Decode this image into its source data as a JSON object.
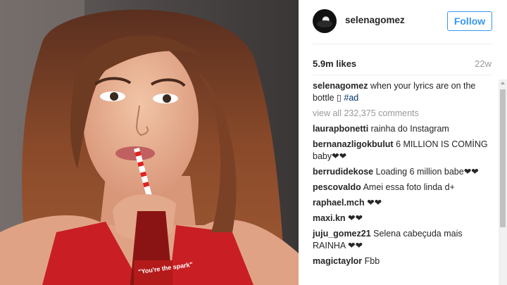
{
  "post": {
    "username": "selenagomez",
    "follow_label": "Follow",
    "likes": "5.9m likes",
    "age": "22w"
  },
  "caption": {
    "username": "selenagomez",
    "text": " when your lyrics are on the bottle ▯ ",
    "hashtag": "#ad"
  },
  "view_all": "view all 232,375 comments",
  "comments": [
    {
      "user": "laurapbonetti",
      "text": " rainha do Instagram"
    },
    {
      "user": "bernanazligokbulut",
      "text": " 6 MILLION IS COMİNG baby❤︎❤︎"
    },
    {
      "user": "berrudidekose",
      "text": " Loading 6 million babe❤︎❤︎"
    },
    {
      "user": "pescovaldo",
      "text": " Amei essa foto linda d+"
    },
    {
      "user": "raphael.mch",
      "text": " ❤︎❤︎"
    },
    {
      "user": "maxi.kn",
      "text": " ❤︎❤︎"
    },
    {
      "user": "juju_gomez21",
      "text": " Selena cabeçuda mais RAINHA ❤︎❤︎"
    },
    {
      "user": "magictaylor",
      "text": " Fbb"
    }
  ],
  "photo": {
    "bottle_label": "\"You're the spark\""
  }
}
